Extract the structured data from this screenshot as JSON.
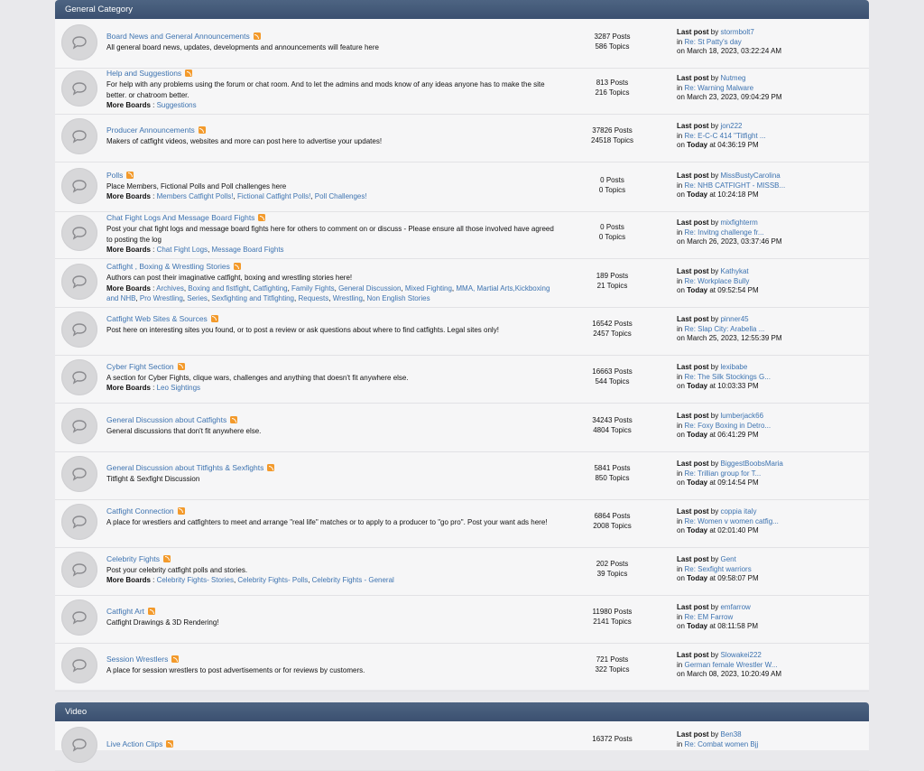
{
  "categories": [
    {
      "title": "General Category",
      "boards": [
        {
          "name": "Board News and General Announcements",
          "desc": "All general board news, updates, developments and announcements will feature here",
          "more_boards": [],
          "posts": "3287 Posts",
          "topics": "586 Topics",
          "lp_by": "stormbolt7",
          "lp_in": "Re: St Patty's day",
          "lp_on_bold": "",
          "lp_on": "on March 18, 2023, 03:22:24 AM"
        },
        {
          "name": "Help and Suggestions",
          "desc": "For help with any problems using the forum or chat room. And to let the admins and mods know of any ideas anyone has to make the site better. or chatroom better.",
          "more_boards": [
            "Suggestions"
          ],
          "posts": "813 Posts",
          "topics": "216 Topics",
          "lp_by": "Nutmeg",
          "lp_in": "Re: Warning Malware",
          "lp_on_bold": "",
          "lp_on": "on March 23, 2023, 09:04:29 PM"
        },
        {
          "name": "Producer Announcements",
          "desc": "Makers of catfight videos, websites and more can post here to advertise your updates!",
          "more_boards": [],
          "posts": "37826 Posts",
          "topics": "24518 Topics",
          "lp_by": "jon222",
          "lp_in": "Re: E-C-C 414 \"Titfight ...",
          "lp_on_bold": "Today",
          "lp_on": "at 04:36:19 PM"
        },
        {
          "name": "Polls",
          "desc": "Place Members, Fictional Polls and Poll challenges here",
          "more_boards": [
            "Members Catfight Polls!",
            "Fictional Catfight Polls!",
            "Poll Challenges!"
          ],
          "posts": "0 Posts",
          "topics": "0 Topics",
          "lp_by": "MissBustyCarolina",
          "lp_in": "Re: NHB CATFIGHT - MISSB...",
          "lp_on_bold": "Today",
          "lp_on": "at 10:24:18 PM"
        },
        {
          "name": "Chat Fight Logs And Message Board Fights",
          "desc": "Post your chat fight logs and message board fights here for others to comment on or discuss - Please ensure all those involved have agreed to posting the log",
          "more_boards": [
            "Chat Fight Logs",
            "Message Board Fights"
          ],
          "posts": "0 Posts",
          "topics": "0 Topics",
          "lp_by": "mixfighterm",
          "lp_in": "Re: Invitng challenge fr...",
          "lp_on_bold": "",
          "lp_on": "on March 26, 2023, 03:37:46 PM"
        },
        {
          "name": "Catfight , Boxing & Wrestling Stories",
          "desc": "Authors can post their imaginative catfight, boxing and wrestling stories here!",
          "more_boards": [
            "Archives",
            "Boxing and fistfight",
            "Catfighting",
            "Family Fights",
            "General Discussion",
            "Mixed Fighting",
            "MMA, Martial Arts,Kickboxing and NHB",
            "Pro Wrestling",
            "Series",
            "Sexfighting and Titfighting",
            "Requests",
            "Wrestling",
            "Non English Stories"
          ],
          "posts": "189 Posts",
          "topics": "21 Topics",
          "lp_by": "Kathykat",
          "lp_in": "Re: Workplace Bully",
          "lp_on_bold": "Today",
          "lp_on": "at 09:52:54 PM"
        },
        {
          "name": "Catfight Web Sites & Sources",
          "desc": "Post here on interesting sites you found, or to post a review or ask questions about where to find catfights. Legal sites only!",
          "more_boards": [],
          "posts": "16542 Posts",
          "topics": "2457 Topics",
          "lp_by": "pinner45",
          "lp_in": "Re: Slap City: Arabella ...",
          "lp_on_bold": "",
          "lp_on": "on March 25, 2023, 12:55:39 PM"
        },
        {
          "name": "Cyber Fight Section",
          "desc": "A section for Cyber Fights, clique wars, challenges and anything that doesn't fit anywhere else.",
          "more_boards": [
            "Leo Sightings"
          ],
          "posts": "16663 Posts",
          "topics": "544 Topics",
          "lp_by": "lexibabe",
          "lp_in": "Re: The Silk Stockings G...",
          "lp_on_bold": "Today",
          "lp_on": "at 10:03:33 PM"
        },
        {
          "name": "General Discussion about Catfights",
          "desc": "General discussions that don't fit anywhere else.",
          "more_boards": [],
          "posts": "34243 Posts",
          "topics": "4804 Topics",
          "lp_by": "lumberjack66",
          "lp_in": "Re: Foxy Boxing in Detro...",
          "lp_on_bold": "Today",
          "lp_on": "at 06:41:29 PM"
        },
        {
          "name": "General Discussion about Titfights & Sexfights",
          "desc": "Titfight & Sexfight Discussion",
          "more_boards": [],
          "posts": "5841 Posts",
          "topics": "850 Topics",
          "lp_by": "BiggestBoobsMaria",
          "lp_in": "Re: Trillian group for T...",
          "lp_on_bold": "Today",
          "lp_on": "at 09:14:54 PM"
        },
        {
          "name": "Catfight Connection",
          "desc": "A place for wrestlers and catfighters to meet and arrange \"real life\" matches or to apply to a producer to \"go pro\". Post your want ads here!",
          "more_boards": [],
          "posts": "6864 Posts",
          "topics": "2008 Topics",
          "lp_by": "coppia italy",
          "lp_in": "Re: Women v women catfig...",
          "lp_on_bold": "Today",
          "lp_on": "at 02:01:40 PM"
        },
        {
          "name": "Celebrity Fights",
          "desc": "Post your celebrity catfight polls and stories.",
          "more_boards": [
            "Celebrity Fights- Stories",
            "Celebrity Fights- Polls",
            "Celebrity Fights - General"
          ],
          "posts": "202 Posts",
          "topics": "39 Topics",
          "lp_by": "Gent",
          "lp_in": "Re: Sexfight warriors",
          "lp_on_bold": "Today",
          "lp_on": "at 09:58:07 PM"
        },
        {
          "name": "Catfight Art",
          "desc": "Catfight Drawings & 3D Rendering!",
          "more_boards": [],
          "posts": "11980 Posts",
          "topics": "2141 Topics",
          "lp_by": "emfarrow",
          "lp_in": "Re: EM Farrow",
          "lp_on_bold": "Today",
          "lp_on": "at 08:11:58 PM"
        },
        {
          "name": "Session Wrestlers",
          "desc": "A place for session wrestlers to post advertisements or for reviews by customers.",
          "more_boards": [],
          "posts": "721 Posts",
          "topics": "322 Topics",
          "lp_by": "Slowakei222",
          "lp_in": "German female Wrestler W...",
          "lp_on_bold": "",
          "lp_on": "on March 08, 2023, 10:20:49 AM"
        }
      ]
    },
    {
      "title": "Video",
      "boards": [
        {
          "name": "Live Action Clips",
          "desc": "",
          "more_boards": [],
          "posts": "16372 Posts",
          "topics": "",
          "lp_by": "Ben38",
          "lp_in": "Re: Combat women Bjj",
          "lp_on_bold": "",
          "lp_on": ""
        }
      ]
    }
  ],
  "labels": {
    "more_boards": "More Boards",
    "last_post": "Last post",
    "by": "by",
    "in": "in",
    "on": "on"
  },
  "colors": {
    "header": "#44597a",
    "link": "#3d73b0",
    "rss": "#f39a2b",
    "icon_bg": "#d7d7d9"
  },
  "icons": {
    "board": "speech-bubble-icon",
    "rss": "rss-icon"
  }
}
